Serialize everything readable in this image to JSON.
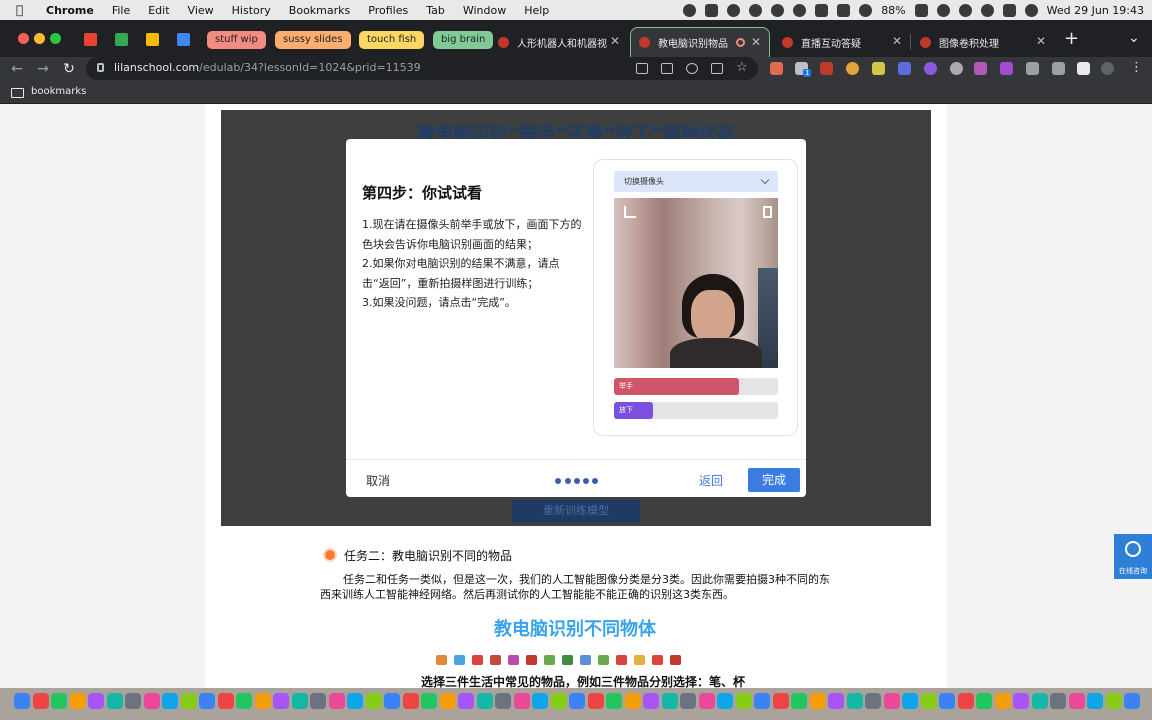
{
  "menubar": {
    "app_name": "Chrome",
    "items": [
      "File",
      "Edit",
      "View",
      "History",
      "Bookmarks",
      "Profiles",
      "Tab",
      "Window",
      "Help"
    ],
    "battery": "88%",
    "datetime": "Wed 29 Jun  19:43"
  },
  "tabs": {
    "groups": [
      {
        "label": "stuff wip",
        "color": "#f28b82"
      },
      {
        "label": "sussy slides",
        "color": "#fcad70"
      },
      {
        "label": "touch fish",
        "color": "#fdd663"
      },
      {
        "label": "big brain",
        "color": "#81c995"
      }
    ],
    "open_tabs": [
      {
        "title": "人形机器人和机器视"
      },
      {
        "title": "教电脑识别物品",
        "active": true
      },
      {
        "title": "直播互动答疑"
      },
      {
        "title": "图像卷积处理"
      }
    ],
    "new_tab": "+",
    "overflow": "⌄"
  },
  "toolbar": {
    "url_host": "lilanschool.com",
    "url_path": "/edulab/34?lessonId=1024&prid=11539",
    "ext_badge": "1"
  },
  "bookmarks": {
    "folder_label": "bookmarks"
  },
  "page": {
    "stage_title": "教电脑识别“举手”还是“放下”两种状态",
    "retrain_button": "重新训练模型",
    "modal": {
      "title": "第四步：你试试看",
      "instructions": "1.现在请在摄像头前举手或放下，画面下方的色块会告诉你电脑识别画面的结果；\n2.如果你对电脑识别的结果不满意，请点击“返回”，重新拍摄样图进行训练；\n3.如果没问题，请点击“完成”。",
      "camera_select": "切换摄像头",
      "results": [
        {
          "label": "举手",
          "confidence": 0.76,
          "color": "#d0546a"
        },
        {
          "label": "放下",
          "confidence": 0.24,
          "color": "#7b4fe0"
        }
      ],
      "cancel_label": "取消",
      "back_label": "返回",
      "done_label": "完成",
      "step_dots": 5
    },
    "task": {
      "title": "任务二：教电脑识别不同的物品",
      "description": "任务二和任务一类似，但是这一次，我们的人工智能图像分类是分3类。因此你需要拍摄3种不同的东西来训练人工智能神经网络。然后再测试你的人工智能能不能正确的识别这3类东西。"
    },
    "section_title": "教电脑识别不同物体",
    "cut_text": "选择三件生活中常见的物品，例如三件物品分别选择：笔、杯",
    "consult_label": "在线咨询"
  }
}
